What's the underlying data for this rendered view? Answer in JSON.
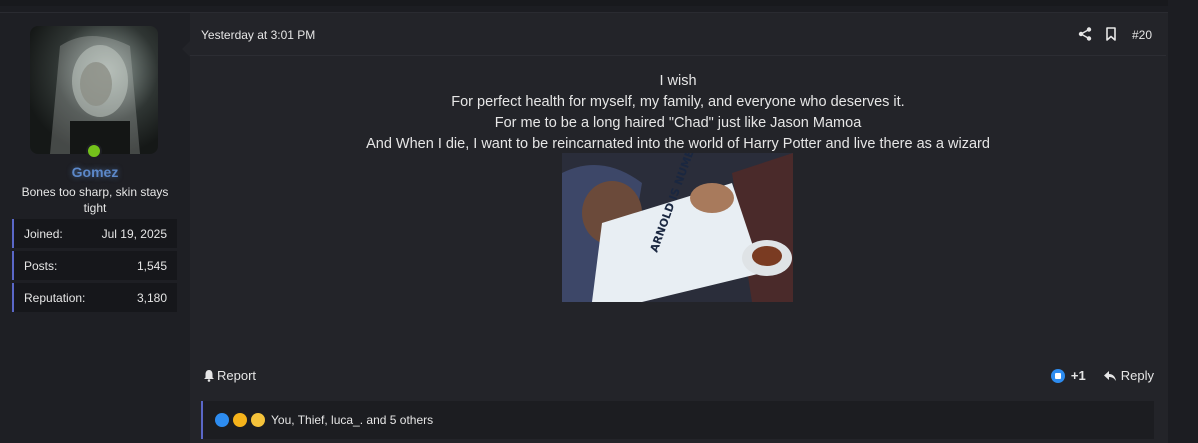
{
  "user": {
    "name": "Gomez",
    "title": "Bones too sharp, skin stays tight",
    "stats": [
      {
        "label": "Joined:",
        "value": "Jul 19, 2025"
      },
      {
        "label": "Posts:",
        "value": "1,545"
      },
      {
        "label": "Reputation:",
        "value": "3,180"
      }
    ]
  },
  "post": {
    "date": "Yesterday at 3:01 PM",
    "number": "#20",
    "lines": [
      "I wish",
      "For perfect health for myself, my family, and everyone who deserves it.",
      "For me to be a long haired \"Chad\" just like Jason Mamoa",
      "And When I die, I want to be reincarnated into the world of Harry Potter and live there as a wizard"
    ],
    "gif_text": "ARNOLD IS NUMERO"
  },
  "footer": {
    "report_label": "Report",
    "like_count": "+1",
    "reply_label": "Reply"
  },
  "reactions": {
    "text": "You, Thief, luca_. and 5 others",
    "icons": [
      "like-icon",
      "star-eyes-icon",
      "laughing-icon"
    ]
  },
  "colors": {
    "username": "#5c88c9",
    "accent_border": "#5a67c7",
    "online": "#74c21b"
  }
}
